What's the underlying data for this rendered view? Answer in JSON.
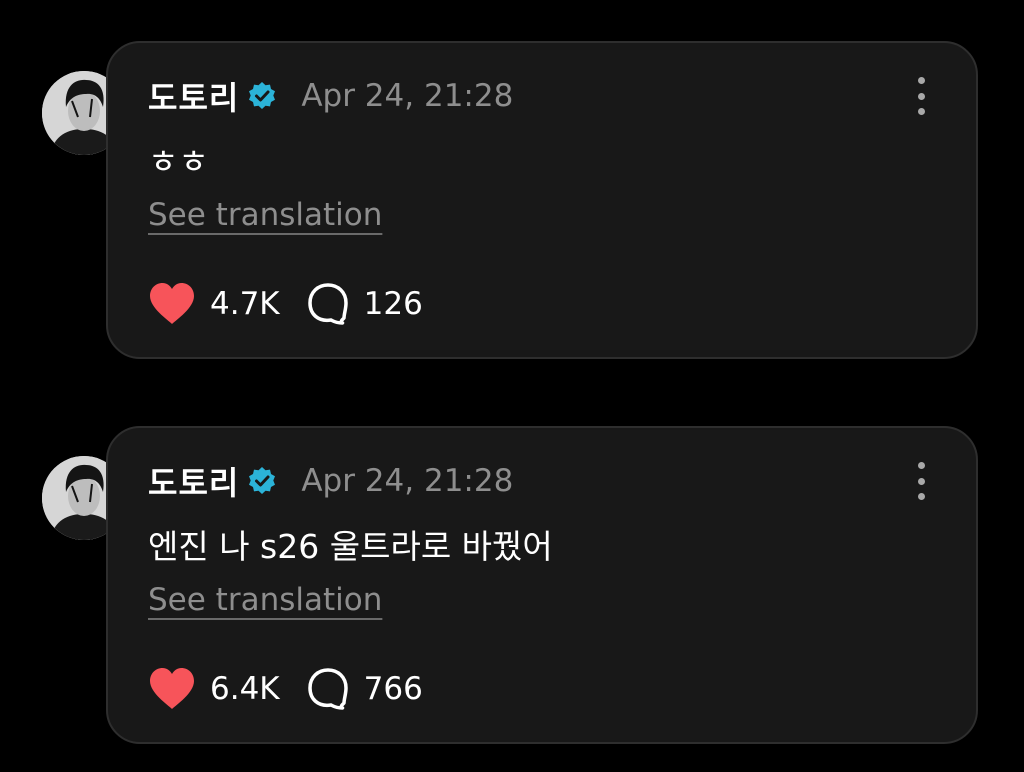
{
  "colors": {
    "background": "#000000",
    "card": "#181818",
    "card_border": "#2e2e2e",
    "muted_text": "#8e8e8e",
    "verified_badge": "#2bb3d8",
    "like_heart": "#f7545a"
  },
  "posts": [
    {
      "username": "도토리",
      "verified": true,
      "timestamp": "Apr 24, 21:28",
      "text": "ㅎㅎ",
      "translate_label": "See translation",
      "likes": "4.7K",
      "replies": "126"
    },
    {
      "username": "도토리",
      "verified": true,
      "timestamp": "Apr 24, 21:28",
      "text": "엔진 나 s26 울트라로 바꿨어",
      "translate_label": "See translation",
      "likes": "6.4K",
      "replies": "766"
    }
  ],
  "icons": {
    "verified": "verified-badge-icon",
    "more": "more-vertical-icon",
    "like": "heart-icon",
    "reply": "speech-bubble-icon"
  }
}
